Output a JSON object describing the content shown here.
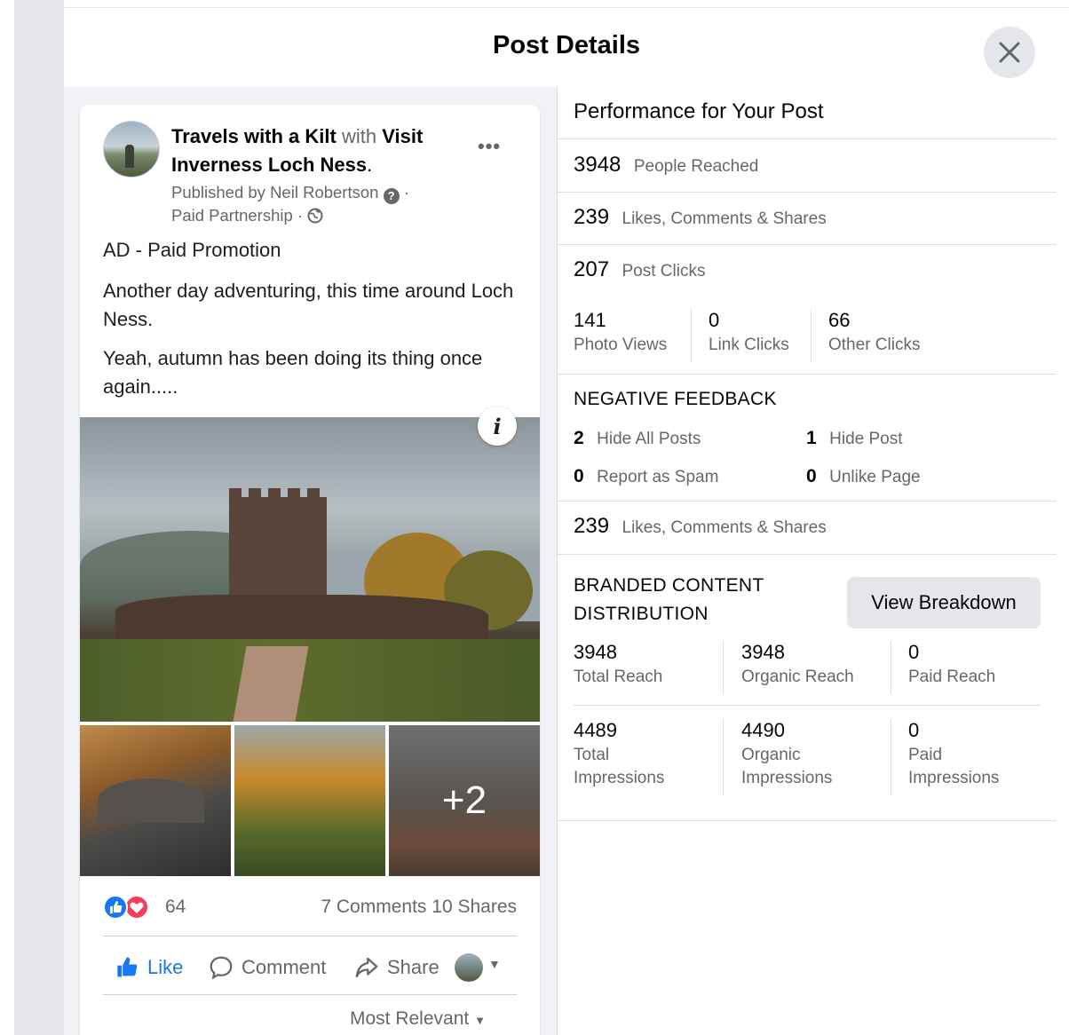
{
  "modal": {
    "title": "Post Details",
    "close_icon": "close-icon"
  },
  "post": {
    "author": "Travels with a Kilt",
    "with_word": "with",
    "partner": "Visit Inverness Loch Ness",
    "published_by": "Published by Neil Robertson",
    "paid_partnership": "Paid Partnership ·",
    "paragraphs": [
      "AD - Paid Promotion",
      "Another day adventuring, this time around Loch Ness.",
      "Yeah, autumn has been doing its thing once again....."
    ],
    "more_photos": "+2",
    "reaction_count": "64",
    "comments": "7 Comments",
    "shares": "10 Shares",
    "actions": {
      "like": "Like",
      "comment": "Comment",
      "share": "Share"
    },
    "sort": "Most Relevant"
  },
  "performance": {
    "title": "Performance for Your Post",
    "people_reached": {
      "value": "3948",
      "label": "People Reached"
    },
    "engagements": {
      "value": "239",
      "label": "Likes, Comments & Shares"
    },
    "post_clicks": {
      "value": "207",
      "label": "Post Clicks"
    },
    "click_breakdown": [
      {
        "value": "141",
        "label": "Photo Views"
      },
      {
        "value": "0",
        "label": "Link Clicks"
      },
      {
        "value": "66",
        "label": "Other Clicks"
      }
    ],
    "negative_feedback": {
      "title": "NEGATIVE FEEDBACK",
      "items": [
        {
          "value": "2",
          "label": "Hide All Posts"
        },
        {
          "value": "1",
          "label": "Hide Post"
        },
        {
          "value": "0",
          "label": "Report as Spam"
        },
        {
          "value": "0",
          "label": "Unlike Page"
        }
      ]
    },
    "engagements2": {
      "value": "239",
      "label": "Likes, Comments & Shares"
    },
    "branded": {
      "title_line1": "BRANDED CONTENT",
      "title_line2": "DISTRIBUTION",
      "button": "View Breakdown",
      "reach": [
        {
          "value": "3948",
          "label": "Total Reach"
        },
        {
          "value": "3948",
          "label": "Organic Reach"
        },
        {
          "value": "0",
          "label": "Paid Reach"
        }
      ],
      "impressions": [
        {
          "value": "4489",
          "label_line1": "Total",
          "label_line2": "Impressions"
        },
        {
          "value": "4490",
          "label_line1": "Organic",
          "label_line2": "Impressions"
        },
        {
          "value": "0",
          "label_line1": "Paid",
          "label_line2": "Impressions"
        }
      ]
    }
  }
}
